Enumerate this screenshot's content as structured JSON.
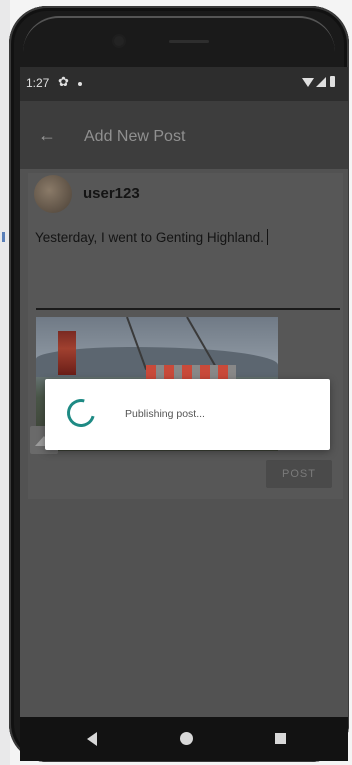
{
  "status_bar": {
    "time": "1:27",
    "gear_glyph": "✿",
    "icons": [
      "settings-icon",
      "notification-dot-icon",
      "wifi-icon",
      "signal-icon",
      "battery-icon"
    ]
  },
  "app_bar": {
    "back_glyph": "←",
    "title": "Add New Post"
  },
  "post": {
    "username": "user123",
    "text": "Yesterday, I went to Genting Highland."
  },
  "actions": {
    "post_label": "POST"
  },
  "dialog": {
    "message": "Publishing post..."
  },
  "colors": {
    "spinner": "#1e8a84",
    "overlay": "#525252",
    "app_bar": "#3d3d3d"
  }
}
